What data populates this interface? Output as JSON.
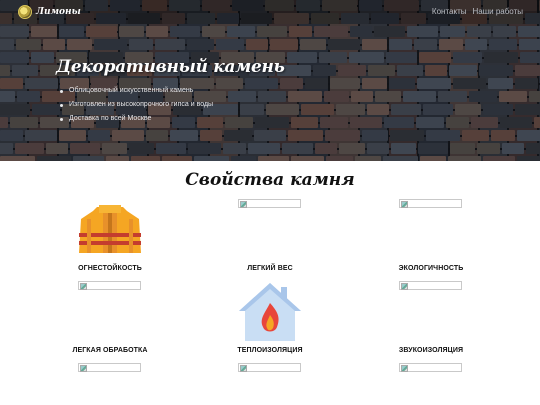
{
  "navbar": {
    "brand": "Лимоны",
    "links": [
      "Контакты",
      "Наши работы"
    ]
  },
  "hero": {
    "title": "Декоративный камень",
    "bullets": [
      "Облицовочный искусственный камень",
      "Изготовлен из высокопрочного гипса и воды",
      "Доставка по всей Москве"
    ]
  },
  "properties": {
    "title": "Свойства камня",
    "items": [
      {
        "label": "ОГНЕСТОЙКОСТЬ",
        "icon": "fire-suit-icon"
      },
      {
        "label": "ЛЕГКИЙ ВЕС",
        "icon": "broken-image-icon"
      },
      {
        "label": "ЭКОЛОГИЧНОСТЬ",
        "icon": "broken-image-icon"
      },
      {
        "label": "ЛЕГКАЯ ОБРАБОТКА",
        "icon": "broken-image-icon"
      },
      {
        "label": "ТЕПЛОИЗОЛЯЦИЯ",
        "icon": "house-fire-icon"
      },
      {
        "label": "ЗВУКОИЗОЛЯЦИЯ",
        "icon": "broken-image-icon"
      }
    ]
  },
  "colors": {
    "accent_orange": "#f5a623",
    "house_blue": "#c9def4",
    "flame_red": "#e8463b"
  }
}
